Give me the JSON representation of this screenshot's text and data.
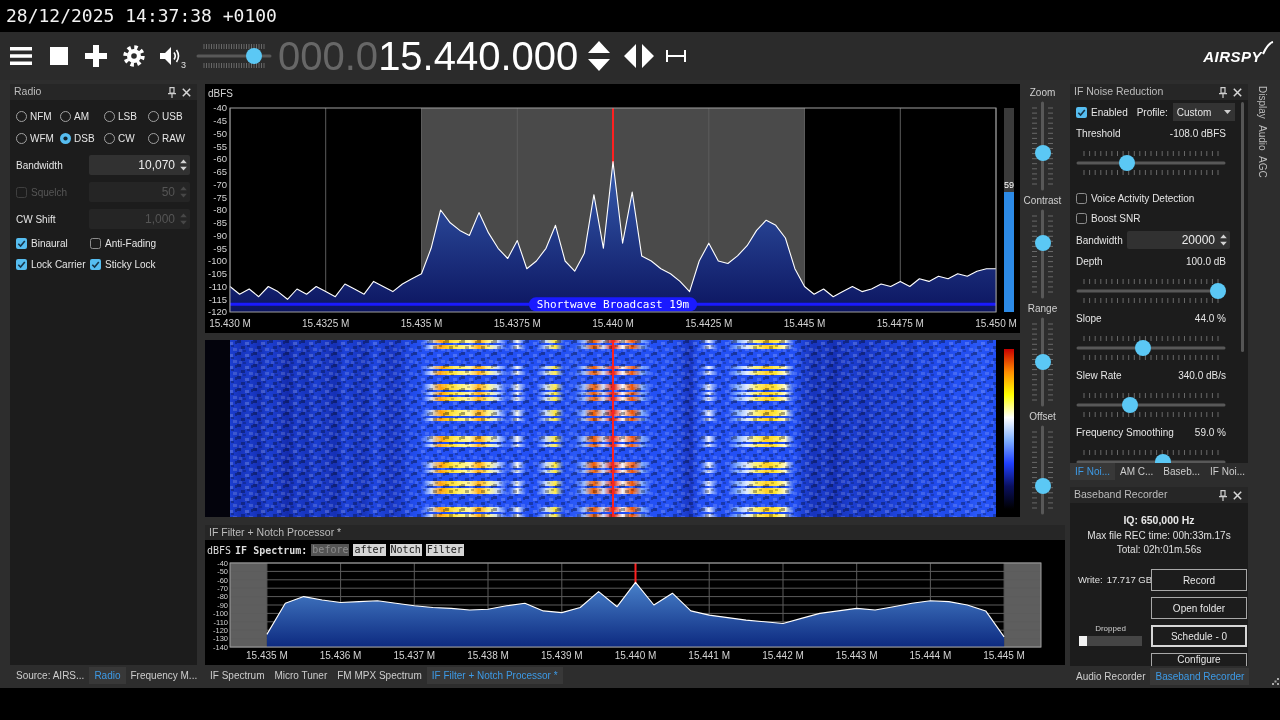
{
  "timestamp": "28/12/2025 14:37:38 +0100",
  "toolbar": {
    "speaker_number": "3",
    "volume": {
      "level": 0.83
    },
    "frequency": {
      "leading_digits": "000.0",
      "digits": "15.440.000"
    },
    "logo": "AIRSPY"
  },
  "radio_panel": {
    "title": "Radio",
    "modes": [
      {
        "label": "NFM",
        "selected": false
      },
      {
        "label": "AM",
        "selected": false
      },
      {
        "label": "LSB",
        "selected": false
      },
      {
        "label": "USB",
        "selected": false
      },
      {
        "label": "WFM",
        "selected": false
      },
      {
        "label": "DSB",
        "selected": true
      },
      {
        "label": "CW",
        "selected": false
      },
      {
        "label": "RAW",
        "selected": false
      }
    ],
    "fields": [
      {
        "kind": "number",
        "label": "Bandwidth",
        "value": "10,070",
        "disabled": false
      },
      {
        "kind": "toggle_number",
        "label": "Squelch",
        "checked": false,
        "label_disabled": true,
        "value": "50",
        "disabled": true
      },
      {
        "kind": "number",
        "label": "CW Shift",
        "value": "1,000",
        "disabled": true
      }
    ],
    "options": [
      {
        "label": "Binaural",
        "checked": true
      },
      {
        "label": "Anti-Fading",
        "checked": false
      },
      {
        "label": "Lock Carrier",
        "checked": true
      },
      {
        "label": "Sticky Lock",
        "checked": true
      }
    ]
  },
  "left_tabs": [
    {
      "label": "Source: AIRS...",
      "selected": false
    },
    {
      "label": "Radio",
      "selected": true
    },
    {
      "label": "Frequency M...",
      "selected": false
    }
  ],
  "spectrum": {
    "signal_meter": {
      "reading": "59",
      "level": 0.59
    },
    "chart_data": [
      {
        "type": "line",
        "ylabel": "dBFS",
        "x": [
          15.43,
          15.43025,
          15.4305,
          15.43075,
          15.431,
          15.43125,
          15.4315,
          15.43175,
          15.432,
          15.43225,
          15.4325,
          15.43275,
          15.433,
          15.43325,
          15.4335,
          15.43375,
          15.434,
          15.43425,
          15.4345,
          15.43475,
          15.435,
          15.43525,
          15.4355,
          15.43575,
          15.436,
          15.43625,
          15.4365,
          15.43675,
          15.437,
          15.43725,
          15.4375,
          15.43775,
          15.438,
          15.43825,
          15.4385,
          15.43875,
          15.439,
          15.43925,
          15.4395,
          15.43975,
          15.44,
          15.44025,
          15.4405,
          15.44075,
          15.441,
          15.44125,
          15.4415,
          15.44175,
          15.442,
          15.44225,
          15.4425,
          15.44275,
          15.443,
          15.44325,
          15.4435,
          15.44375,
          15.444,
          15.44425,
          15.4445,
          15.44475,
          15.445,
          15.44525,
          15.4455,
          15.44575,
          15.446,
          15.44625,
          15.4465,
          15.44675,
          15.447,
          15.44725,
          15.4475,
          15.44775,
          15.448,
          15.44825,
          15.4485,
          15.44875,
          15.449,
          15.44925,
          15.4495,
          15.44975,
          15.45
        ],
        "values": [
          -110,
          -113,
          -111,
          -114,
          -110,
          -112,
          -115,
          -111,
          -113,
          -110,
          -112,
          -114,
          -109,
          -111,
          -113,
          -108,
          -110,
          -112,
          -109,
          -107,
          -105,
          -95,
          -80,
          -85,
          -88,
          -90,
          -81,
          -89,
          -95,
          -99,
          -92,
          -103,
          -100,
          -95,
          -86,
          -100,
          -104,
          -97,
          -74,
          -95,
          -61,
          -93,
          -73,
          -98,
          -100,
          -103,
          -105,
          -108,
          -112,
          -100,
          -93,
          -100,
          -101,
          -98,
          -94,
          -88,
          -84,
          -86,
          -91,
          -103,
          -110,
          -113,
          -111,
          -114,
          -112,
          -110,
          -112,
          -111,
          -109,
          -110,
          -108,
          -110,
          -107,
          -108,
          -106,
          -107,
          -105,
          -106,
          -104,
          -103,
          -103
        ],
        "color": "#ffffff",
        "xlim": [
          15.43,
          15.45
        ],
        "ylim": [
          -120,
          -40
        ],
        "xticks": [
          {
            "value": 15.43,
            "label": "15.430 M"
          },
          {
            "value": 15.4325,
            "label": "15.4325 M"
          },
          {
            "value": 15.435,
            "label": "15.435 M"
          },
          {
            "value": 15.4375,
            "label": "15.4375 M"
          },
          {
            "value": 15.44,
            "label": "15.440 M"
          },
          {
            "value": 15.4425,
            "label": "15.4425 M"
          },
          {
            "value": 15.445,
            "label": "15.445 M"
          },
          {
            "value": 15.4475,
            "label": "15.4475 M"
          },
          {
            "value": 15.45,
            "label": "15.450 M"
          }
        ],
        "yticks": [
          -40,
          -45,
          -50,
          -55,
          -60,
          -65,
          -70,
          -75,
          -80,
          -85,
          -90,
          -95,
          -100,
          -105,
          -110,
          -115,
          -120
        ],
        "bands": [
          {
            "axis": "x",
            "from": 15.435,
            "to": 15.445,
            "color": "#4a4a4a"
          }
        ],
        "ref_lines": [
          {
            "axis": "x",
            "value": 15.44,
            "color": "#ff2020"
          },
          {
            "axis": "y",
            "value": -117,
            "label": "Shortwave Broadcast 19m",
            "color": "#1a1aff"
          }
        ],
        "grid": "x"
      }
    ]
  },
  "display_controls": [
    {
      "label": "Zoom",
      "level": 0.41
    },
    {
      "label": "Contrast",
      "level": 0.64
    },
    {
      "label": "Range",
      "level": 0.5
    },
    {
      "label": "Offset",
      "level": 0.29
    }
  ],
  "if_filter_panel": {
    "title": "IF Filter + Notch Processor *",
    "spectrum_label": "IF Spectrum:",
    "toggles": [
      {
        "label": "before",
        "selected": true
      },
      {
        "label": "after",
        "selected": false
      },
      {
        "label": "Notch",
        "selected": false
      },
      {
        "label": "Filter",
        "selected": false
      }
    ],
    "chart_data": [
      {
        "type": "line",
        "ylabel": "dBFS",
        "x": [
          15.435,
          15.43525,
          15.4355,
          15.43575,
          15.436,
          15.43625,
          15.4365,
          15.43675,
          15.437,
          15.43725,
          15.4375,
          15.43775,
          15.438,
          15.43825,
          15.4385,
          15.43875,
          15.439,
          15.43925,
          15.4395,
          15.43975,
          15.44,
          15.44025,
          15.4405,
          15.44075,
          15.441,
          15.44125,
          15.4415,
          15.44175,
          15.442,
          15.44225,
          15.4425,
          15.44275,
          15.443,
          15.44325,
          15.4435,
          15.44375,
          15.444,
          15.44425,
          15.4445,
          15.44475,
          15.445
        ],
        "values": [
          -125,
          -88,
          -80,
          -84,
          -87,
          -86,
          -85,
          -88,
          -91,
          -93,
          -94,
          -96,
          -95,
          -91,
          -88,
          -97,
          -99,
          -93,
          -74,
          -92,
          -63,
          -90,
          -76,
          -97,
          -102,
          -105,
          -108,
          -110,
          -112,
          -106,
          -100,
          -97,
          -94,
          -96,
          -92,
          -88,
          -85,
          -86,
          -90,
          -97,
          -128
        ],
        "color": "#ffffff",
        "xlim": [
          15.4345,
          15.4455
        ],
        "ylim": [
          -140,
          -40
        ],
        "xticks": [
          {
            "value": 15.435,
            "label": "15.435 M"
          },
          {
            "value": 15.436,
            "label": "15.436 M"
          },
          {
            "value": 15.437,
            "label": "15.437 M"
          },
          {
            "value": 15.438,
            "label": "15.438 M"
          },
          {
            "value": 15.439,
            "label": "15.439 M"
          },
          {
            "value": 15.44,
            "label": "15.440 M"
          },
          {
            "value": 15.441,
            "label": "15.441 M"
          },
          {
            "value": 15.442,
            "label": "15.442 M"
          },
          {
            "value": 15.443,
            "label": "15.443 M"
          },
          {
            "value": 15.444,
            "label": "15.444 M"
          },
          {
            "value": 15.445,
            "label": "15.445 M"
          }
        ],
        "yticks": [
          -40,
          -50,
          -60,
          -70,
          -80,
          -90,
          -100,
          -110,
          -120,
          -130,
          -140
        ],
        "bands": [
          {
            "axis": "x",
            "from": 15.4345,
            "to": 15.435,
            "color": "#5e5e5e"
          },
          {
            "axis": "x",
            "from": 15.445,
            "to": 15.4455,
            "color": "#5e5e5e"
          }
        ],
        "ref_lines": [
          {
            "axis": "x",
            "value": 15.44,
            "color": "#ff2020"
          }
        ],
        "grid": true
      }
    ]
  },
  "center_tabs": [
    {
      "label": "IF Spectrum",
      "selected": false
    },
    {
      "label": "Micro Tuner",
      "selected": false
    },
    {
      "label": "FM MPX Spectrum",
      "selected": false
    },
    {
      "label": "IF Filter + Notch Processor *",
      "selected": true
    }
  ],
  "noise_reduction_panel": {
    "title": "IF Noise Reduction",
    "enabled": {
      "label": "Enabled",
      "checked": true
    },
    "profile": {
      "label": "Profile:",
      "value": "Custom"
    },
    "controls": [
      {
        "kind": "slider",
        "label": "Threshold",
        "reading": "-108.0 dBFS",
        "level": 0.32
      },
      {
        "kind": "checkbox",
        "label": "Voice Activity Detection",
        "checked": false
      },
      {
        "kind": "checkbox",
        "label": "Boost SNR",
        "checked": false
      },
      {
        "kind": "number",
        "label": "Bandwidth",
        "value": "20000"
      },
      {
        "kind": "slider",
        "label": "Depth",
        "reading": "100.0 dB",
        "level": 1.0
      },
      {
        "kind": "slider",
        "label": "Slope",
        "reading": "44.0 %",
        "level": 0.44
      },
      {
        "kind": "slider",
        "label": "Slew Rate",
        "reading": "340.0 dB/s",
        "level": 0.34
      },
      {
        "kind": "slider",
        "label": "Frequency Smoothing",
        "reading": "59.0 %",
        "level": 0.59
      }
    ],
    "tabs": [
      {
        "label": "IF Noi...",
        "selected": true
      },
      {
        "label": "AM C...",
        "selected": false
      },
      {
        "label": "Baseb...",
        "selected": false
      },
      {
        "label": "IF Noi...",
        "selected": false
      }
    ]
  },
  "side_tabs": [
    {
      "label": "Display",
      "selected": false
    },
    {
      "label": "Audio",
      "selected": false
    },
    {
      "label": "AGC",
      "selected": false
    }
  ],
  "baseband_panel": {
    "title": "Baseband Recorder",
    "iq": "IQ: 650,000 Hz",
    "max_file_time": "Max file REC time: 00h:33m.17s",
    "total": "Total: 02h:01m.56s",
    "write": {
      "label": "Write:",
      "value": "17.717 GB"
    },
    "dropped": {
      "label": "Dropped",
      "level": 0.12
    },
    "buttons": [
      {
        "label": "Record",
        "focused": false
      },
      {
        "label": "Open folder",
        "focused": false
      },
      {
        "label": "Schedule - 0",
        "focused": true
      },
      {
        "label": "Configure",
        "focused": false
      }
    ]
  },
  "right_tabs": [
    {
      "label": "Audio Recorder",
      "selected": false
    },
    {
      "label": "Baseband Recorder",
      "selected": true
    }
  ]
}
